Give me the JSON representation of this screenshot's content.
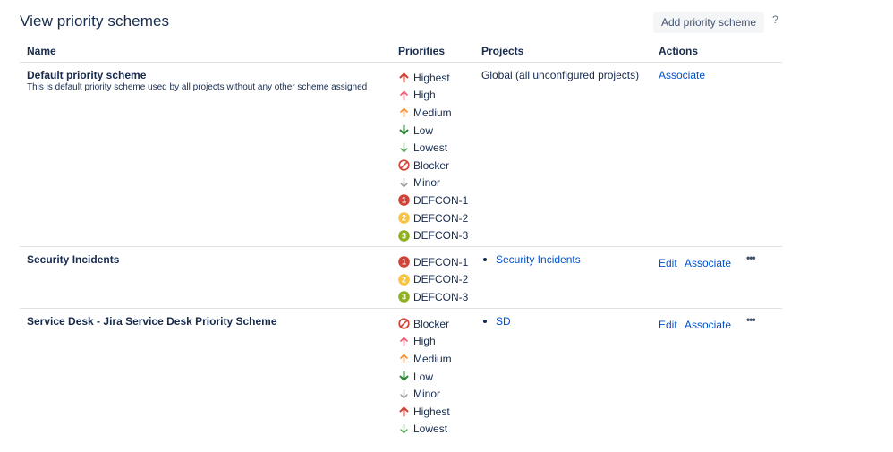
{
  "page": {
    "title": "View priority schemes",
    "add_button_label": "Add priority scheme",
    "help_label": "?"
  },
  "table": {
    "headers": {
      "name": "Name",
      "priorities": "Priorities",
      "projects": "Projects",
      "actions": "Actions"
    }
  },
  "priority_icons": {
    "Highest": {
      "icon": "arrow-up-icon",
      "color": "#d04437"
    },
    "High": {
      "icon": "arrow-up-small-icon",
      "color": "#f15c75"
    },
    "Medium": {
      "icon": "arrow-up-small-icon",
      "color": "#f79232"
    },
    "Low": {
      "icon": "arrow-down-icon",
      "color": "#2a8735"
    },
    "Lowest": {
      "icon": "arrow-down-small-icon",
      "color": "#55a557"
    },
    "Blocker": {
      "icon": "blocked-icon",
      "color": "#d04437"
    },
    "Minor": {
      "icon": "arrow-down-small-icon",
      "color": "#999999"
    },
    "DEFCON-1": {
      "icon": "badge-1-icon",
      "color": "#d04437"
    },
    "DEFCON-2": {
      "icon": "badge-2-icon",
      "color": "#f6c342"
    },
    "DEFCON-3": {
      "icon": "badge-3-icon",
      "color": "#8eb021"
    }
  },
  "schemes": [
    {
      "name": "Default priority scheme",
      "description": "This is default priority scheme used by all projects without any other scheme assigned",
      "priorities": [
        "Highest",
        "High",
        "Medium",
        "Low",
        "Lowest",
        "Blocker",
        "Minor",
        "DEFCON-1",
        "DEFCON-2",
        "DEFCON-3"
      ],
      "projects_text": "Global (all unconfigured projects)",
      "projects": [],
      "actions": {
        "edit": "",
        "associate": "Associate",
        "more": ""
      }
    },
    {
      "name": "Security Incidents",
      "description": "",
      "priorities": [
        "DEFCON-1",
        "DEFCON-2",
        "DEFCON-3"
      ],
      "projects_text": "",
      "projects": [
        "Security Incidents"
      ],
      "actions": {
        "edit": "Edit",
        "associate": "Associate",
        "more": "•••"
      }
    },
    {
      "name": "Service Desk - Jira Service Desk Priority Scheme",
      "description": "",
      "priorities": [
        "Blocker",
        "High",
        "Medium",
        "Low",
        "Minor",
        "Highest",
        "Lowest"
      ],
      "projects_text": "",
      "projects": [
        "SD"
      ],
      "actions": {
        "edit": "Edit",
        "associate": "Associate",
        "more": "•••"
      }
    }
  ]
}
